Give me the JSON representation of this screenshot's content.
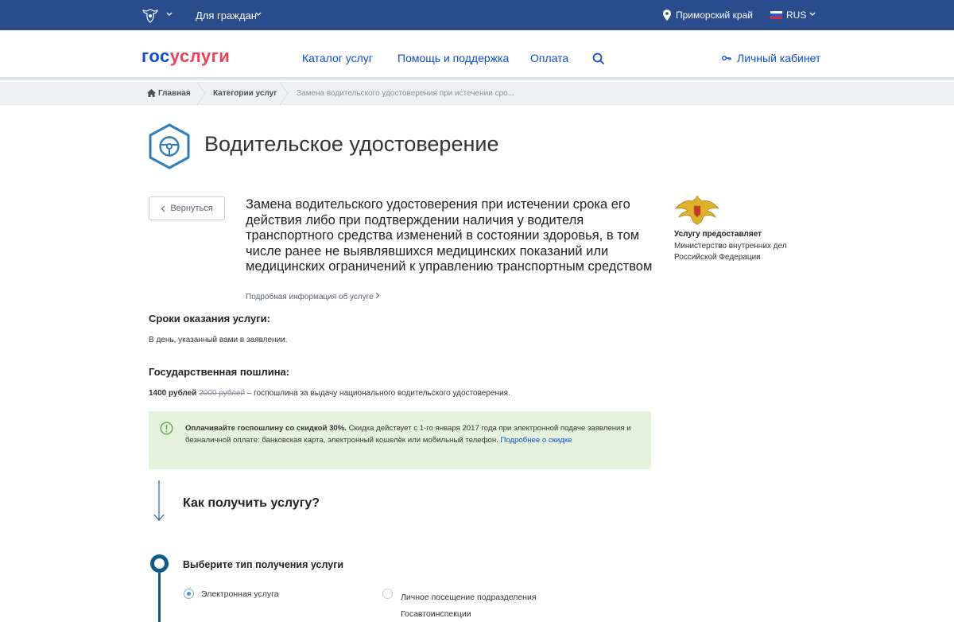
{
  "topbar": {
    "citizens": "Для граждан",
    "region": "Приморский край",
    "lang": "RUS"
  },
  "header": {
    "logo_part1": "гос",
    "logo_part2": "услуги",
    "nav": [
      "Каталог услуг",
      "Помощь и поддержка",
      "Оплата"
    ],
    "cabinet": "Личный кабинет"
  },
  "breadcrumb": {
    "home": "Главная",
    "categories": "Категории услуг",
    "current": "Замена водительского удостоверения при истечении сро..."
  },
  "page": {
    "title": "Водительское удостоверение",
    "back": "Вернуться"
  },
  "service": {
    "title": "Замена водительского удостоверения при истечении срока его действия либо при подтверждении наличия у водителя транспортного средства изменений в состоянии здоровья, в том числе ранее не выявлявшихся медицинских показаний или медицинских ограничений к управлению транспортным средством",
    "more": "Подробная информация об услуге"
  },
  "provider": {
    "label": "Услугу предоставляет",
    "name": "Министерство внутренних дел Российской Федерации"
  },
  "terms": {
    "heading": "Сроки оказания услуги:",
    "text": "В день, указанный вами в заявлении."
  },
  "fee": {
    "heading": "Государственная пошлина:",
    "price": "1400 рублей",
    "old_price": "2000 рублей",
    "desc": "– госпошлина за выдачу национального водительского удостоверения."
  },
  "notice": {
    "bold": "Оплачивайте госпошлину со скидкой 30%.",
    "text": "Скидка действует с 1-го января 2017 года при электронной подаче заявления и безналичной оплате: банковская карта, электронный кошелёк или мобильный телефон.",
    "link": "Подробнее о скидке"
  },
  "how": {
    "title": "Как получить услугу?",
    "step_title": "Выберите тип получения услуги",
    "options": [
      {
        "label": "Электронная услуга",
        "selected": true
      },
      {
        "label": "Личное посещение подразделения Госавтоинспекции",
        "selected": false
      }
    ]
  },
  "colors": {
    "topbar": "#2b4c8c",
    "brand_blue": "#0d4cd3",
    "brand_red": "#ee3f58",
    "notice_bg": "#e5f3dc",
    "step": "#0e5a8e"
  }
}
